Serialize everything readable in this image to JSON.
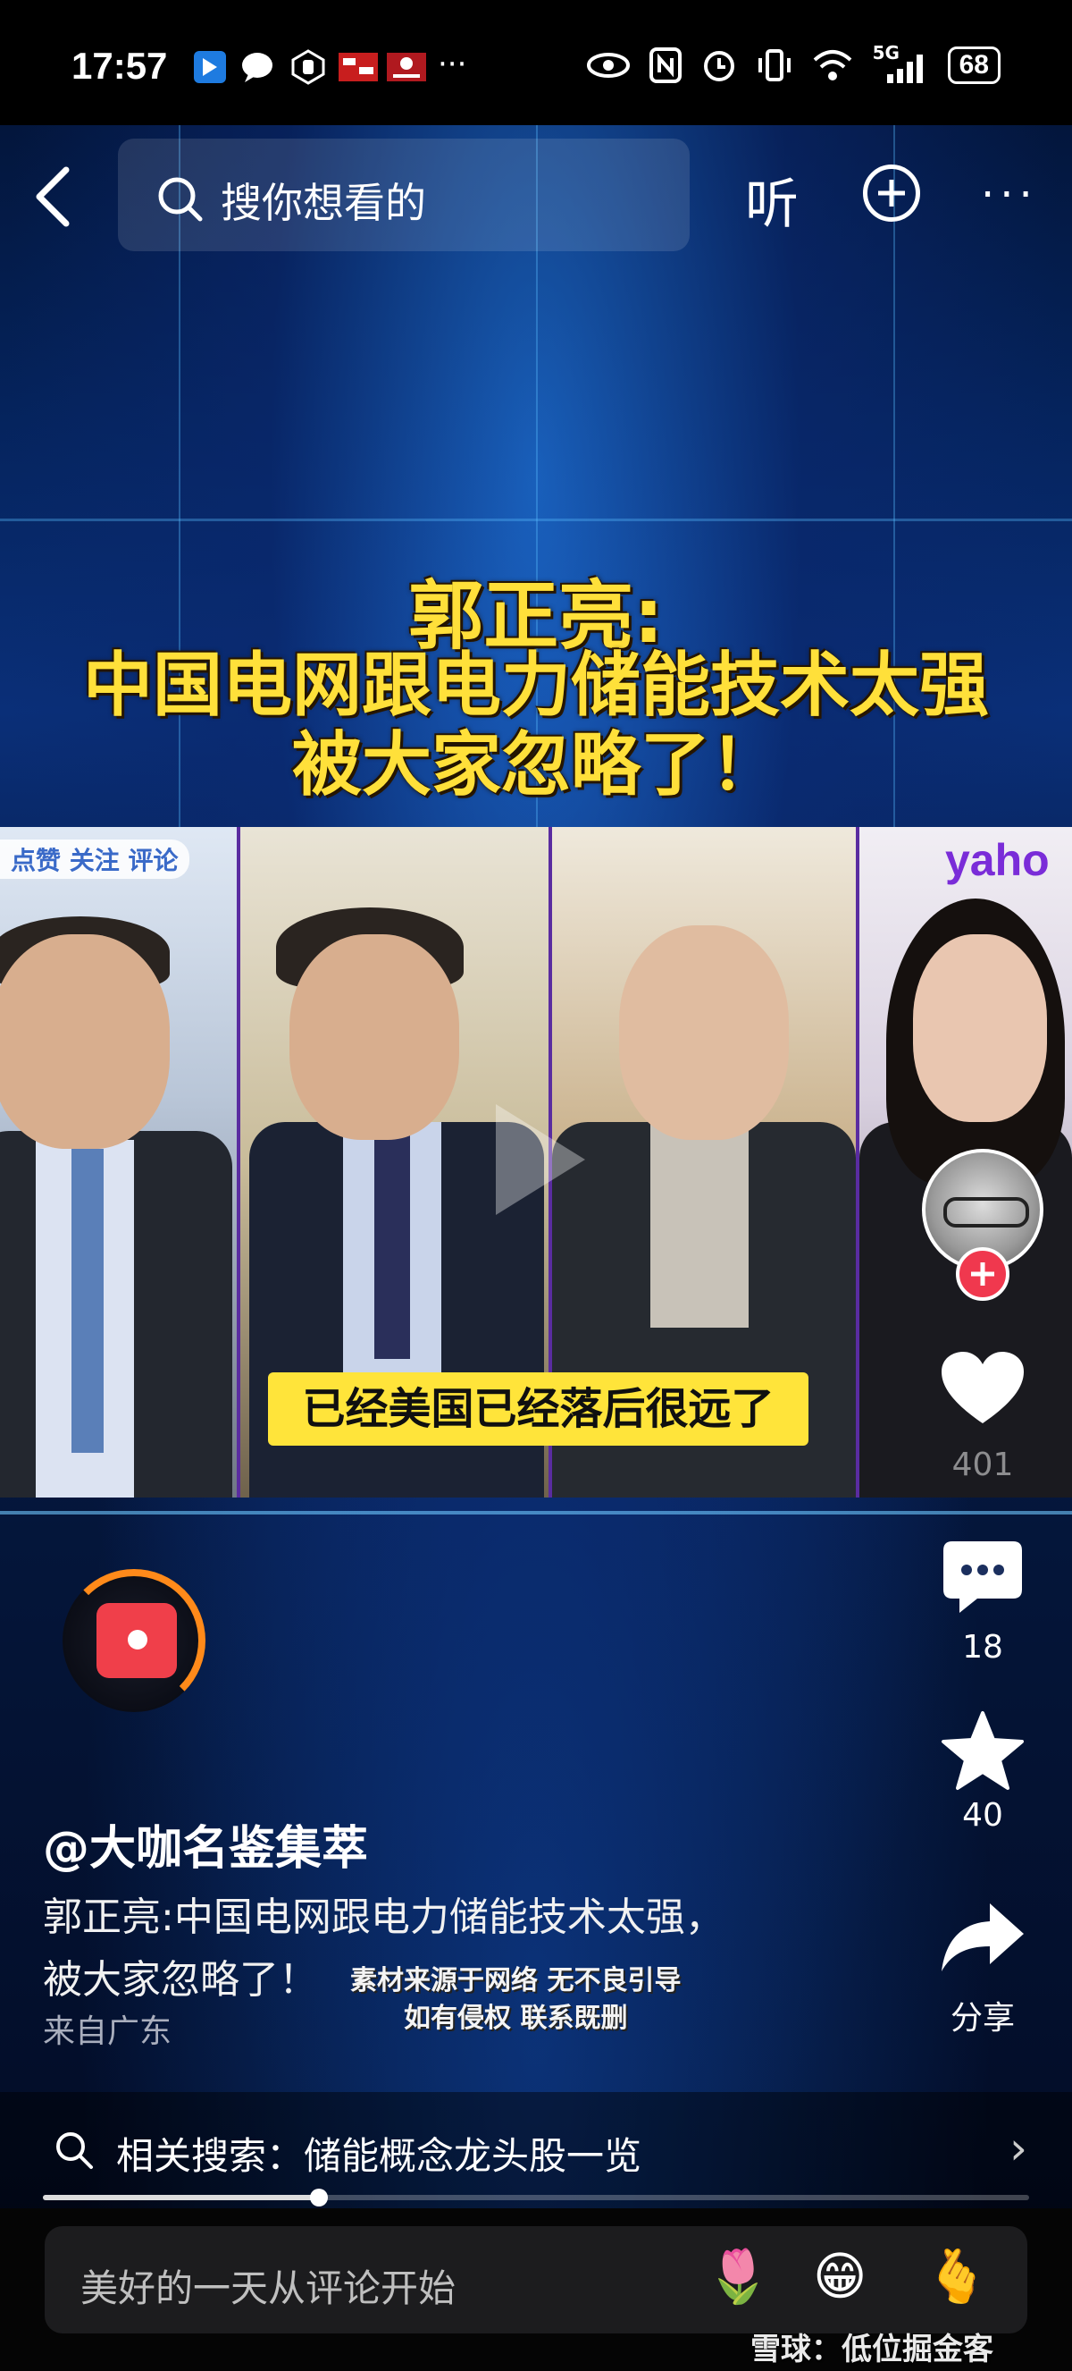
{
  "status_bar": {
    "time": "17:57",
    "network": "5G",
    "battery": "68"
  },
  "nav": {
    "search_placeholder": "搜你想看的",
    "listen_label": "听",
    "more_label": "···"
  },
  "video": {
    "headline_line1": "郭正亮:",
    "headline_line2": "中国电网跟电力储能技术太强",
    "headline_line3": "被大家忽略了！",
    "overlay_badge": "点赞 关注 评论",
    "channel_mark": "yaho",
    "subtitle": "已经美国已经落后很远了"
  },
  "rail": {
    "like_count": "401",
    "comment_count": "18",
    "favorite_count": "40",
    "share_label": "分享"
  },
  "post": {
    "author": "@大咖名鉴集萃",
    "desc_line1": "郭正亮:中国电网跟电力储能技术太强，",
    "desc_line2": "被大家忽略了！",
    "location": "来自广东",
    "watermark_line1": "素材来源于网络 无不良引导",
    "watermark_line2": "如有侵权 联系既删"
  },
  "related": {
    "label": "相关搜索：储能概念龙头股一览"
  },
  "progress": {
    "fraction": 0.28
  },
  "comment": {
    "placeholder": "美好的一天从评论开始",
    "emoji": [
      "🌷",
      "😁",
      "🫰"
    ]
  },
  "watermark_site": "雪球：低位掘金客",
  "colors": {
    "accent_red": "#f0384e",
    "headline_yellow": "#ffe03a",
    "disc_ring": "#ff8a1a"
  }
}
